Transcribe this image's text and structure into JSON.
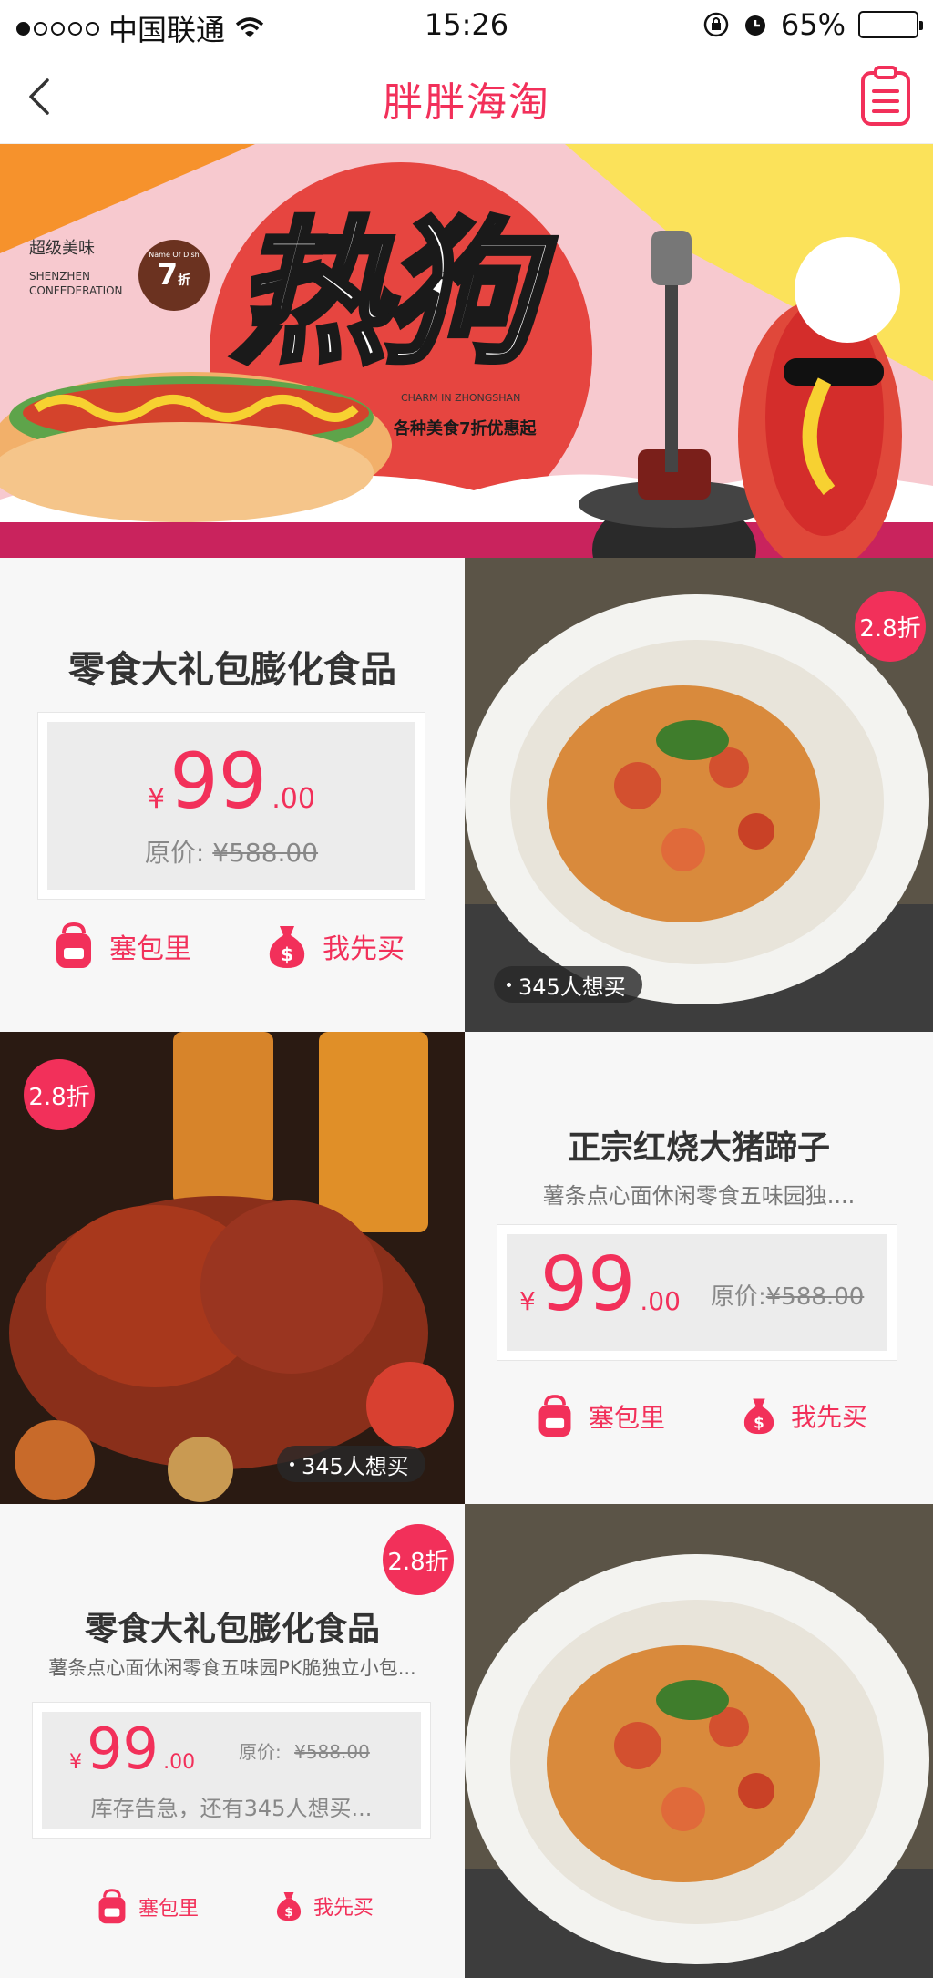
{
  "status_bar": {
    "carrier": "中国联通",
    "time": "15:26",
    "battery": "65%",
    "battery_level": 0.65
  },
  "nav": {
    "title": "胖胖海淘"
  },
  "banner": {
    "tag_line": "超级美味",
    "en_line1": "SHENZHEN",
    "en_line2": "CONFEDERATION",
    "seal_top": "Name Of Dish",
    "seal_main": "7",
    "seal_suffix": "折",
    "headline": "热狗",
    "charm": "CHARM IN ZHONGSHAN",
    "promo": "各种美食7折优惠起"
  },
  "products": [
    {
      "title": "零食大礼包膨化食品",
      "currency": "¥",
      "price_int": "99",
      "price_dec": ".00",
      "orig_label": "原价:",
      "orig_price": "¥588.00",
      "action_bag": "塞包里",
      "action_buy": "我先买"
    },
    {
      "badge": "2.8折",
      "want": "345人想买"
    },
    {
      "badge": "2.8折",
      "want": "345人想买"
    },
    {
      "title": "正宗红烧大猪蹄子",
      "subtitle": "薯条点心面休闲零食五味园独....",
      "currency": "¥",
      "price_int": "99",
      "price_dec": ".00",
      "orig_label": "原价:",
      "orig_price": "¥588.00",
      "action_bag": "塞包里",
      "action_buy": "我先买"
    },
    {
      "badge": "2.8折",
      "title": "零食大礼包膨化食品",
      "subtitle": "薯条点心面休闲零食五味园PK脆独立小包...",
      "currency": "¥",
      "price_int": "99",
      "price_dec": ".00",
      "orig_label": "原价:",
      "orig_price": "¥588.00",
      "stock_note": "库存告急，还有345人想买...",
      "action_bag": "塞包里",
      "action_buy": "我先买"
    }
  ]
}
